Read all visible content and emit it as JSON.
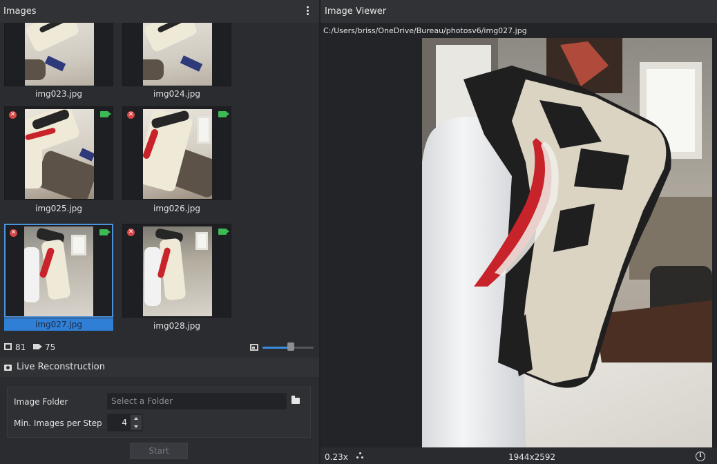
{
  "images_panel": {
    "title": "Images",
    "menu_icon": "kebab-vertical-icon",
    "thumbnails": [
      {
        "name": "img023.jpg",
        "selected": false,
        "error": false,
        "camera": false
      },
      {
        "name": "img024.jpg",
        "selected": false,
        "error": false,
        "camera": false
      },
      {
        "name": "img025.jpg",
        "selected": false,
        "error": true,
        "camera": true
      },
      {
        "name": "img026.jpg",
        "selected": false,
        "error": true,
        "camera": true
      },
      {
        "name": "img027.jpg",
        "selected": true,
        "error": true,
        "camera": true
      },
      {
        "name": "img028.jpg",
        "selected": false,
        "error": true,
        "camera": true
      }
    ],
    "stats": {
      "images_count": "81",
      "cameras_count": "75"
    },
    "thumbnail_size_level": 0.55
  },
  "live_reconstruction": {
    "title": "Live Reconstruction",
    "image_folder_label": "Image Folder",
    "image_folder_placeholder": "Select a Folder",
    "min_images_label": "Min. Images per Step",
    "min_images_value": "4",
    "start_label": "Start"
  },
  "image_viewer": {
    "title": "Image Viewer",
    "path": "C:/Users/briss/OneDrive/Bureau/photosv6/img027.jpg",
    "zoom": "0.23x",
    "resolution": "1944x2592"
  },
  "colors": {
    "accent": "#2f7fd6",
    "error_badge": "#d94646",
    "camera_badge": "#3cba54",
    "panel_bg": "#2b2c30"
  }
}
